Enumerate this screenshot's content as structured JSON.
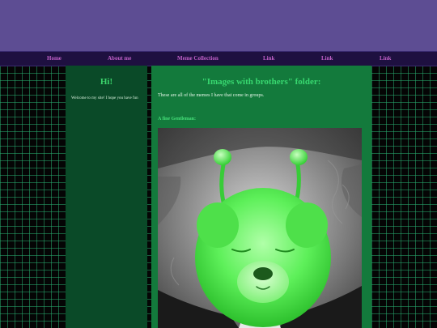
{
  "nav": {
    "items": [
      {
        "label": "Home"
      },
      {
        "label": "About me"
      },
      {
        "label": "Meme Collection"
      },
      {
        "label": "Link"
      },
      {
        "label": "Link"
      },
      {
        "label": "Link"
      }
    ]
  },
  "sidebar": {
    "heading": "Hi!",
    "text": "Welcome to my site! I hope you have fun"
  },
  "main": {
    "title": "\"Images with brothers\" folder:",
    "intro": "These are all of the memes I have that come in groups.",
    "meme_title": "A fine Gentleman:"
  },
  "colors": {
    "banner": "#5d4d93",
    "nav_bg": "#1e1040",
    "nav_link": "#c060c8",
    "sidebar_bg": "#0a4a28",
    "main_bg": "#137a3c",
    "heading_green": "#38d870"
  }
}
